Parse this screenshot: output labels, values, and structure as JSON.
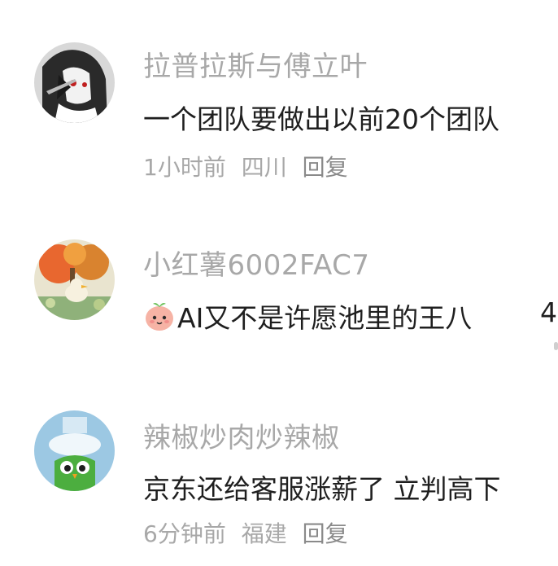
{
  "comments": [
    {
      "username": "拉普拉斯与傅立叶",
      "content": "一个团队要做出以前20个团队",
      "meta": {
        "time": "1小时前",
        "location": "四川",
        "reply_label": "回复"
      },
      "avatar_icon": "anime-character-avatar"
    },
    {
      "username": "小红薯6002FAC7",
      "emoji_icon": "red-bean-face-emoji",
      "content": "AI又不是许愿池里的王八",
      "trailing_partial": "4",
      "avatar_icon": "illustrated-scene-avatar"
    },
    {
      "username": "辣椒炒肉炒辣椒",
      "content": "京东还给客服涨薪了 立判高下",
      "meta": {
        "time": "6分钟前",
        "location": "福建",
        "reply_label": "回复"
      },
      "avatar_icon": "green-owl-avatar"
    }
  ]
}
